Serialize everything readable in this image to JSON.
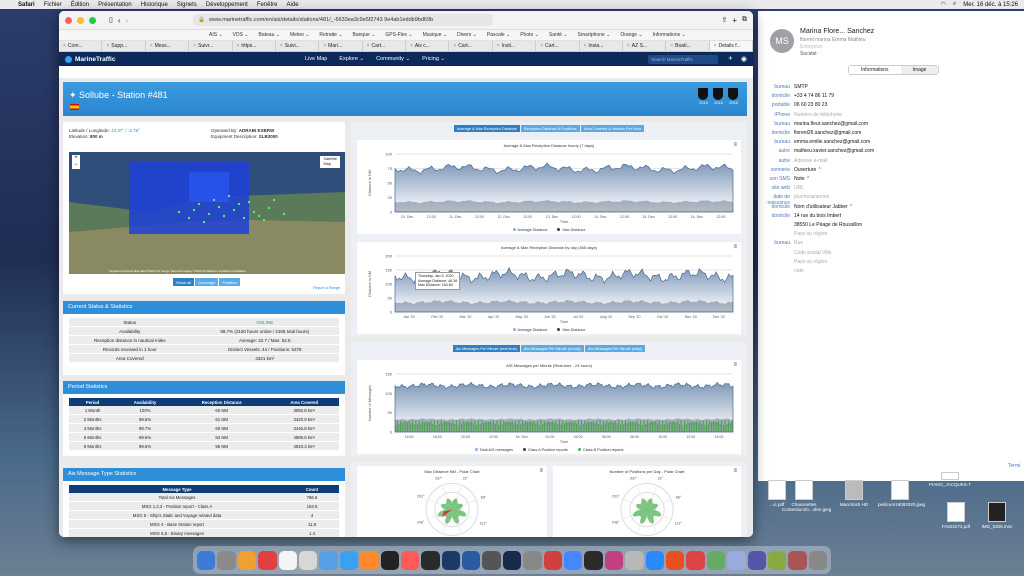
{
  "menubar": {
    "app": "Safari",
    "items": [
      "Fichier",
      "Édition",
      "Présentation",
      "Historique",
      "Signets",
      "Développement",
      "Fenêtre",
      "Aide"
    ],
    "clock": "Mer. 16 déc. à 15:26"
  },
  "browser": {
    "url": "www.marinetraffic.com/en/ais/details/stations/481/_-6633ea3c9e5f2743 9e4ab1eddb9bd69b",
    "favorites": [
      "AIS ⌄",
      "VDS ⌄",
      "Bateau ⌄",
      "Meteo ⌄",
      "Retraite ⌄",
      "Banque ⌄",
      "GPS-Flex ⌄",
      "Musique ⌄",
      "Divers ⌄",
      "Pascale ⌄",
      "Photo ⌄",
      "Santé ⌄",
      "Smartphone ⌄",
      "Orange ⌄",
      "Informations ⌄"
    ],
    "tabs": [
      "Com...",
      "Supp...",
      "Mess...",
      "Suivr...",
      "https...",
      "Suivi...",
      "Mari...",
      "Cart...",
      "Ais c...",
      "Cart...",
      "Insti...",
      "Cart...",
      "Insta...",
      "AZ S...",
      "Boati...",
      "Details f..."
    ]
  },
  "mt": {
    "logo": "MarineTraffic",
    "nav": [
      "Live Map",
      "Explore ⌄",
      "Community ⌄",
      "Pricing ⌄"
    ],
    "search": "Search MarineTraffic"
  },
  "station": {
    "title": "Sollube - Station #481",
    "badges": [
      "2015",
      "2016",
      "2018"
    ],
    "latlon_label": "Latitude / Longitude:",
    "latlon": "43.37° / -2.76°",
    "elev_label": "Elevation:",
    "elev": "800 m",
    "operator_label": "Operated By:",
    "operator": "ADRABI ESBRW",
    "equip_label": "Equipment Description:",
    "equip": "SLB3000",
    "map_buttons": [
      "Show all",
      "Coverage",
      "Position"
    ],
    "map_toggle": [
      "Satellite",
      "Map"
    ],
    "map_attrib": "Keyboard shortcuts  Map data ©2020 Inst. Geogr. Nacional Imagery ©2020 TerraMetrics  Conditions d'utilisation",
    "report": "Report a Range"
  },
  "current": {
    "title": "Current Status & Statistics",
    "rows": [
      [
        "Status",
        "ONLINE"
      ],
      [
        "Availability",
        "99.7% (2150 hours online / 2158 total hours)"
      ],
      [
        "Reception distance in nautical miles",
        "Average: 22.7 / Max: 52.8"
      ],
      [
        "Records received in 1 hour",
        "Distinct Vessels: 44 / Positions: 5378"
      ],
      [
        "Area Covered",
        "3321 km²"
      ]
    ]
  },
  "period": {
    "title": "Period Statistics",
    "headers": [
      "Period",
      "Availability",
      "Reception Distance",
      "Area Covered"
    ],
    "rows": [
      [
        "1 Month",
        "100%",
        "60 NM",
        "3050.8 km²"
      ],
      [
        "2 Months",
        "99.6%",
        "61 NM",
        "3420.9 km²"
      ],
      [
        "3 Months",
        "99.7%",
        "60 NM",
        "3446.8 km²"
      ],
      [
        "6 Months",
        "99.6%",
        "84 NM",
        "4889.6 km²"
      ],
      [
        "9 Months",
        "99.5%",
        "96 NM",
        "4910.3 km²"
      ]
    ]
  },
  "msg": {
    "title": "Ais Message Type Statistics",
    "headers": [
      "Message Type",
      "Count"
    ],
    "rows": [
      [
        "Total Ais Messages",
        "786.6"
      ],
      [
        "MSG 1,2,3 - Position report - Class A",
        "153.5"
      ],
      [
        "MSG 5 - Ship's Static and Voyage related data",
        "4"
      ],
      [
        "MSG 4 - Base Station report",
        "11.8"
      ],
      [
        "MSG 6,8 - Binary messages",
        "1.4"
      ]
    ]
  },
  "charts": {
    "tabs1": [
      "Average & Max Reception Distance",
      "Reception Distance & Positions",
      "Area Covered & Vessels Per Hour"
    ],
    "c1": {
      "title": "Average & Max Reception Distance hourly (7 days)",
      "ylabel": "Distance in NM",
      "xlabel": "Time",
      "ticks_y": [
        "100",
        "75",
        "50",
        "25",
        "0"
      ],
      "ticks_x": [
        "10. Dec",
        "12:00",
        "11. Dec",
        "12:00",
        "12. Dec",
        "12:00",
        "13. Dec",
        "12:00",
        "14. Dec",
        "12:00",
        "15. Dec",
        "12:00",
        "16. Dec",
        "12:00"
      ],
      "legend": [
        "Average Distance",
        "Max Distance"
      ]
    },
    "c2": {
      "title": "Average & Max Reception Distance by day (365 days)",
      "ylabel": "Distance in NM",
      "xlabel": "Time",
      "ticks_y": [
        "200",
        "150",
        "100",
        "50",
        "0"
      ],
      "ticks_x": [
        "Jan '20",
        "Feb '20",
        "Mar '20",
        "Apr '20",
        "May '20",
        "Jun '20",
        "Jul '20",
        "Aug '20",
        "Sep '20",
        "Oct '20",
        "Nov '20",
        "Dec '20"
      ],
      "legend": [
        "Average Distance",
        "Max Distance"
      ],
      "tooltip": [
        "Thursday, Jan 9, 2020",
        "Average Distance: 46.36",
        "Max Distance: 163.84"
      ]
    },
    "tabs2": [
      "Ais Messages Per Minute (real time)",
      "Ais Messages Per Minute (hourly)",
      "Ais Messages Per Minute (daily)"
    ],
    "c3": {
      "title": "AIS Messages per Minute (Real-time - 24 hours)",
      "ylabel": "Number of Messages",
      "xlabel": "Time",
      "ticks_y": [
        "150",
        "100",
        "50",
        "0"
      ],
      "ticks_x": [
        "16:00",
        "18:00",
        "20:00",
        "22:00",
        "16. Dec",
        "02:00",
        "04:00",
        "06:00",
        "08:00",
        "10:00",
        "12:00",
        "14:00"
      ],
      "legend": [
        "Total AIS messages",
        "Class A Position reports",
        "Class B Position reports"
      ]
    },
    "c4": {
      "title": "Max Distance NM - Polar Chart",
      "angles": [
        "337°",
        "23°",
        "293°",
        "68°",
        "248°",
        "113°",
        "203°",
        "158°"
      ]
    },
    "c5": {
      "title": "Number of Positions per Day - Polar Chart",
      "angles": [
        "337°",
        "23°",
        "293°",
        "68°",
        "248°",
        "113°",
        "203°",
        "158°"
      ]
    }
  },
  "contact": {
    "name": "Marina Flore...  Sanchez",
    "sub": "florent marina Emma Mathieu",
    "company": "Entreprise",
    "societe": "Société",
    "tabs": [
      "Informations",
      "Image"
    ],
    "rows": [
      [
        "bureau",
        "SMTP"
      ],
      [
        "domicile",
        "+33 4 74 86 11 79"
      ],
      [
        "portable",
        "06 60 23 80 23"
      ],
      [
        "iPhone",
        "Numéro de téléphone"
      ],
      [
        "bureau",
        "marina.fleur.sanchez@gmail.com"
      ],
      [
        "domicile",
        "florent26.sanchez@gmail.com"
      ],
      [
        "bureau",
        "emma.emilie.sanchez@gmail.com"
      ],
      [
        "autre",
        "mathieu.xavier.sanchez@gmail.com"
      ],
      [
        "autre",
        "Adresse e-mail"
      ],
      [
        "sonnerie",
        "Ouverture ⌃"
      ],
      [
        "son SMS",
        "Note ⌃"
      ],
      [
        "site web",
        "URL"
      ],
      [
        "date de naissance",
        "jour/mois/année"
      ],
      [
        "domicile",
        "Nom d'utilisateur   Jabber ⌃"
      ],
      [
        "domicile",
        "14 rue du bois Imbert"
      ],
      [
        "",
        "38550 Le Péage de Roussillon"
      ],
      [
        "",
        "Pays ou région"
      ],
      [
        "bureau",
        "Rue"
      ],
      [
        "",
        "Code postal  Ville"
      ],
      [
        "",
        "Pays ou région"
      ],
      [
        "",
        "note"
      ]
    ]
  },
  "desktop": {
    "icons": [
      "Chaussettes Contention20...obre.jpeg",
      "Macintosh HD",
      "pedicure16092020.jpeg",
      "PIANO_JACQUES-T",
      "COURTEAUX.pdf",
      "FA022272.pdf",
      "IMG_5325.mov",
      "...ic.pdf"
    ],
    "termi": "Termi"
  },
  "colors": {
    "accent": "#2e8fd8",
    "navy": "#0b2a5b",
    "online": "#3a9d3a"
  }
}
